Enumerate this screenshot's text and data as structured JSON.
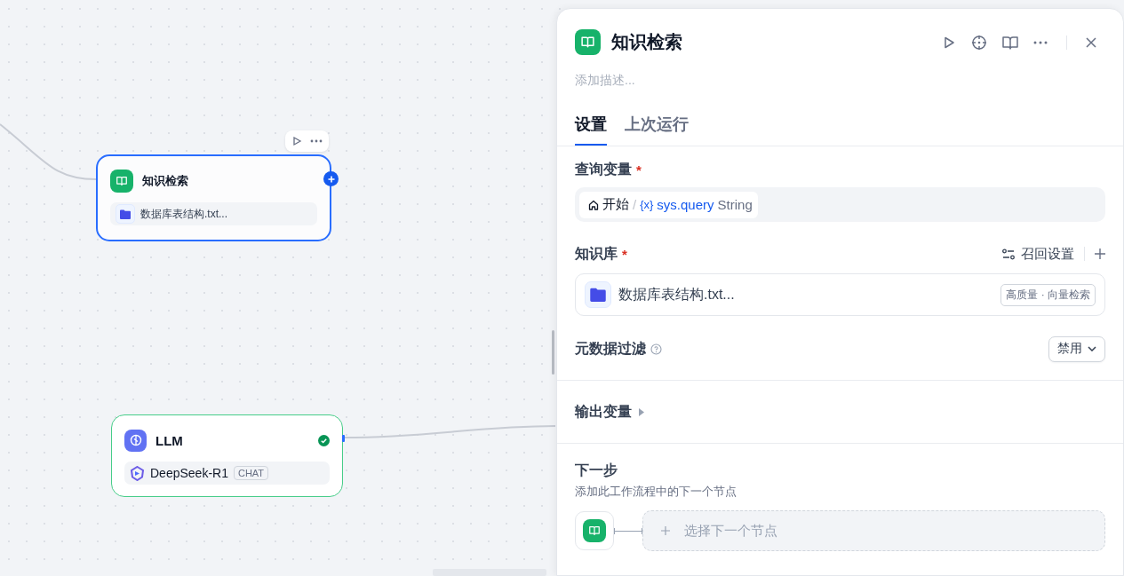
{
  "canvas": {
    "nodes": [
      {
        "kind": "knowledge",
        "title": "知识检索",
        "selected": true,
        "item": "数据库表结构.txt..."
      },
      {
        "kind": "llm",
        "title": "LLM",
        "selected": false,
        "succeeded": true,
        "model": "DeepSeek-R1",
        "badge": "CHAT"
      }
    ]
  },
  "panel": {
    "title": "知识检索",
    "description_placeholder": "添加描述...",
    "tabs": [
      {
        "label": "设置",
        "selected": true
      },
      {
        "label": "上次运行",
        "selected": false
      }
    ],
    "query_variable": {
      "label": "查询变量",
      "required": true,
      "required_mark": "*",
      "source": "开始",
      "separator": "/",
      "marker": "{x}",
      "variable": "sys.query",
      "type": "String"
    },
    "knowledge": {
      "label": "知识库",
      "required": true,
      "required_mark": "*",
      "recall_settings": "召回设置",
      "items": [
        {
          "name": "数据库表结构.txt...",
          "tag": "高质量 · 向量检索"
        }
      ]
    },
    "metadata_filter": {
      "label": "元数据过滤",
      "value": "禁用"
    },
    "output": {
      "label": "输出变量",
      "expanded": false
    },
    "next_step": {
      "title": "下一步",
      "description": "添加此工作流程中的下一个节点",
      "action": "选择下一个节点"
    }
  }
}
